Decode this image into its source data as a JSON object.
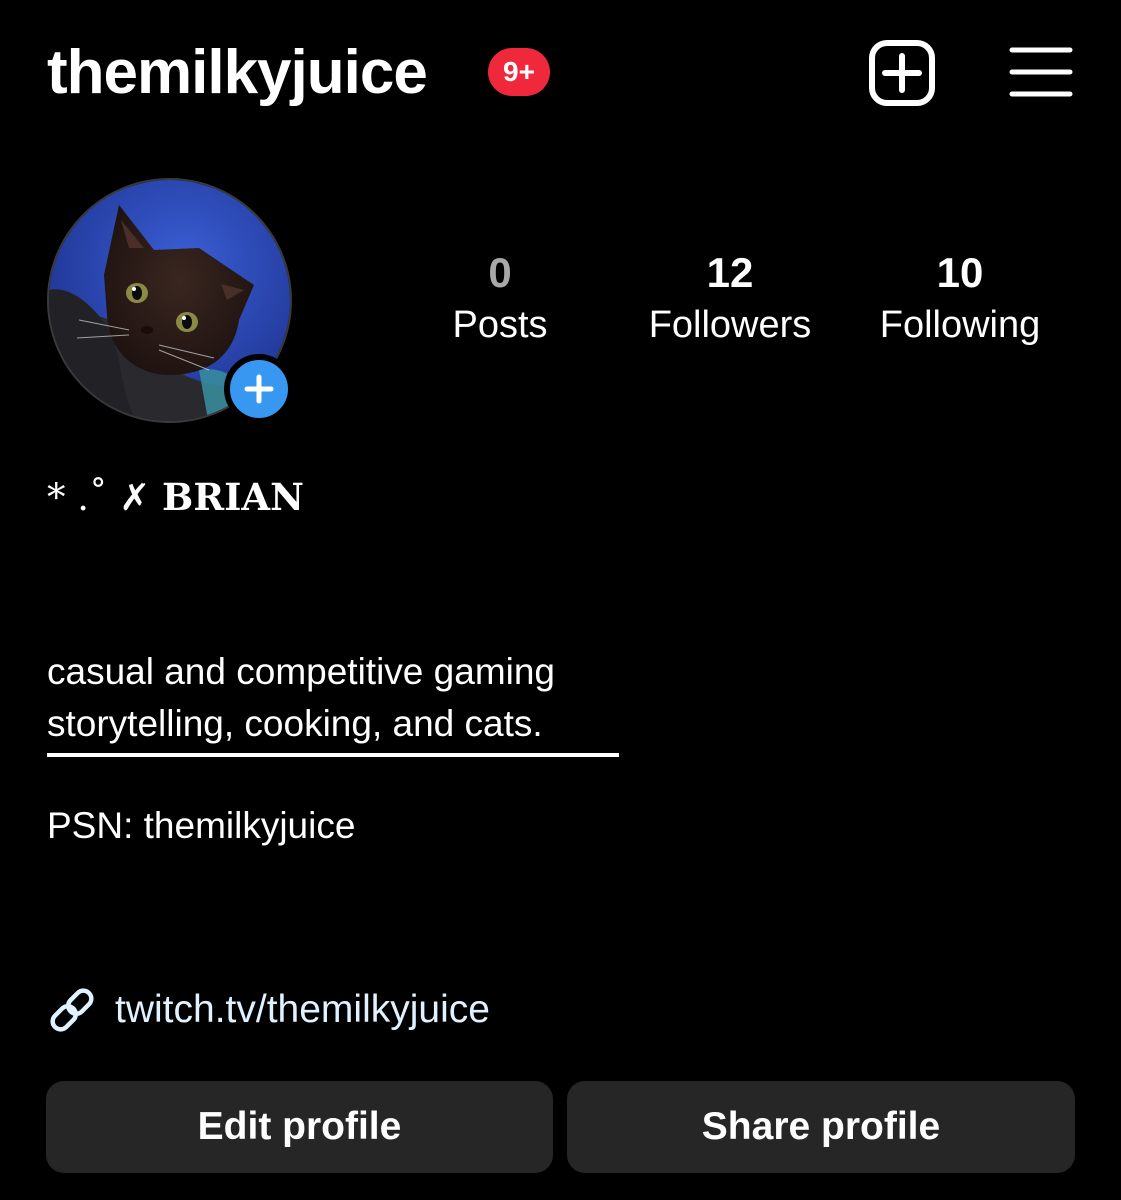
{
  "header": {
    "username": "themilkyjuice",
    "notification_badge": "9+",
    "new_post_icon": "plus-square-icon",
    "menu_icon": "hamburger-menu-icon"
  },
  "profile": {
    "avatar_icon": "cat-avatar",
    "add_story_icon": "plus-icon",
    "stats": {
      "posts": {
        "count": "0",
        "label": "Posts"
      },
      "followers": {
        "count": "12",
        "label": "Followers"
      },
      "following": {
        "count": "10",
        "label": "Following"
      }
    },
    "display_name": {
      "decoration": "* .˚ ✗ ",
      "name": "BRIAN"
    },
    "bio": {
      "line1": "casual and competitive gaming",
      "line2": "storytelling, cooking, and cats.",
      "psn": "PSN: themilkyjuice"
    },
    "link": {
      "icon": "link-icon",
      "text": "twitch.tv/themilkyjuice"
    }
  },
  "actions": {
    "edit_label": "Edit profile",
    "share_label": "Share profile"
  },
  "colors": {
    "background": "#000000",
    "badge": "#f0283c",
    "accent_blue": "#3897f0",
    "button_bg": "#262626",
    "muted_text": "#a8a8a8"
  }
}
